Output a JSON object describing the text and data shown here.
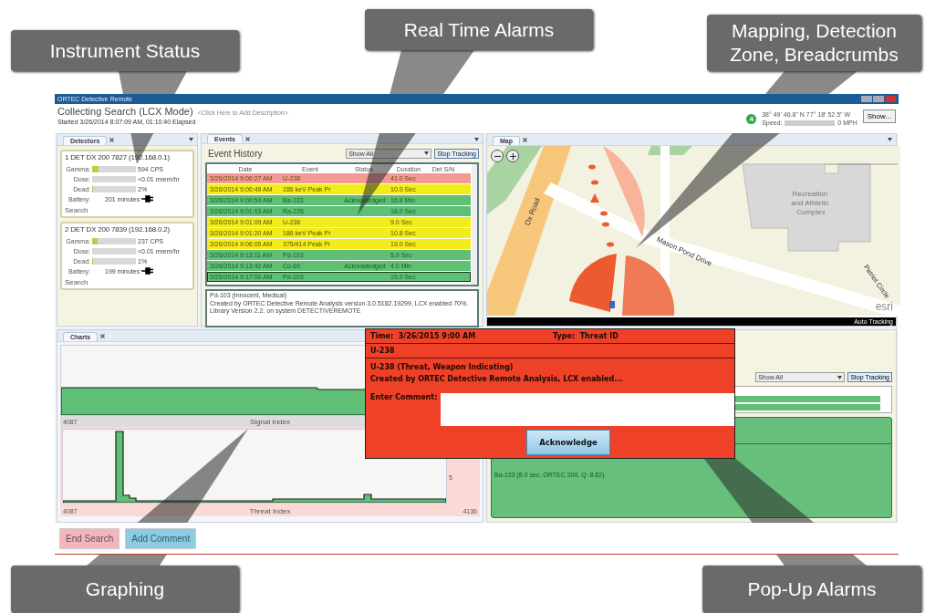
{
  "callouts": [
    {
      "label": "Instrument Status"
    },
    {
      "label": "Real Time Alarms"
    },
    {
      "label": "Mapping, Detection Zone, Breadcrumbs"
    },
    {
      "label": "Graphing"
    },
    {
      "label": "Pop-Up Alarms"
    }
  ],
  "window": {
    "title": "ORTEC Detective Remote",
    "search_title": "Collecting Search (LCX Mode)",
    "description_placeholder": "<Click Here to Add Description>",
    "started": "Started 3/26/2014 8:07:09 AM, 01:10:40 Elapsed",
    "gps_count": "4",
    "coordinates": "38° 49' 46.8\" N 77° 18' 52.5\" W",
    "speed_label": "Speed:",
    "speed": "0 MPH",
    "show_button": "Show..."
  },
  "detectors": {
    "tab": "Detectors",
    "items": [
      {
        "name": "1 DET DX 200 7827 (192.168.0.1)",
        "meters": [
          {
            "label": "Gamma:",
            "level": 0.15,
            "reading": "594 CPS"
          },
          {
            "label": "Dose:",
            "level": 0,
            "reading": "<0.01 mrem/hr"
          },
          {
            "label": "Dead:",
            "level": 0.02,
            "reading": "2%"
          }
        ],
        "battery_label": "Battery:",
        "battery": "201 minutes",
        "action": "Search"
      },
      {
        "name": "2 DET DX 200 7839 (192.168.0.2)",
        "meters": [
          {
            "label": "Gamma:",
            "level": 0.12,
            "reading": "237 CPS"
          },
          {
            "label": "Dose:",
            "level": 0,
            "reading": "<0.01 mrem/hr"
          },
          {
            "label": "Dead:",
            "level": 0.01,
            "reading": "1%"
          }
        ],
        "battery_label": "Battery:",
        "battery": "199 minutes",
        "action": "Search"
      }
    ]
  },
  "events": {
    "tab": "Events",
    "heading": "Event History",
    "filter": "Show All",
    "stop_button": "Stop Tracking",
    "columns": [
      "Date",
      "Event",
      "Status",
      "Duration",
      "Det S/N"
    ],
    "rows": [
      {
        "date": "3/26/2014 9:00:27 AM",
        "event": "U-238",
        "duration": "41.0 Sec",
        "color": "#f49a96",
        "selected": false
      },
      {
        "date": "3/26/2014 9:00:49 AM",
        "event": "186 keV Peak Pr",
        "duration": "10.0 Sec",
        "color": "#f2ec1a",
        "selected": false
      },
      {
        "date": "3/26/2014 9:00:54 AM",
        "event": "Ba-133",
        "status": "Acknowledged",
        "duration": "16.8 Min",
        "color": "#5fbf75",
        "selected": false
      },
      {
        "date": "3/26/2014 9:01:03 AM",
        "event": "Ra-226",
        "duration": "18.0 Sec",
        "color": "#5fbf75",
        "selected": false
      },
      {
        "date": "3/26/2014 9:01:09 AM",
        "event": "U-238",
        "duration": "9.0 Sec",
        "color": "#f2ec1a",
        "selected": false
      },
      {
        "date": "3/26/2014 9:01:20 AM",
        "event": "186 keV Peak Pr",
        "duration": "10.8 Sec",
        "color": "#f2ec1a",
        "selected": false
      },
      {
        "date": "3/26/2014 9:06:05 AM",
        "event": "375/414 Peak Pr",
        "duration": "19.0 Sec",
        "color": "#f2ec1a",
        "selected": false
      },
      {
        "date": "3/26/2014 9:13:11 AM",
        "event": "Pd-103",
        "duration": "5.9 Sec",
        "color": "#5fbf75",
        "selected": false
      },
      {
        "date": "3/26/2014 9:13:42 AM",
        "event": "Co-60",
        "status": "Acknowledged",
        "duration": "4.0 Min",
        "color": "#5fbf75",
        "selected": false
      },
      {
        "date": "3/26/2014 9:17:00 AM",
        "event": "Pd-103",
        "duration": "15.0 Sec",
        "color": "#5fbf75",
        "selected": true
      }
    ],
    "detail_title": "Pd-103 (Innocent, Medical)",
    "detail_text": "Created by ORTEC Detective Remote Analysis version 3.0.5182.19299. LCX enabled 70%. Library Version 2.2. on system DETECTIVEREMOTE"
  },
  "map": {
    "tab": "Map",
    "labels": [
      "Ox Road",
      "Mason Pond Drive",
      "Recreation and Athletic Complex",
      "Patriot Circle"
    ],
    "attribution": "esri",
    "status": "Auto Tracking"
  },
  "charts": {
    "tab": "Charts",
    "signal_label": "Signal Index",
    "signal_start": "4087",
    "threat_label": "Threat Index",
    "threat_start": "4087",
    "threat_end": "4136",
    "threat_tick": "5"
  },
  "events_lower": {
    "filter": "Show All",
    "stop_button": "Stop Tracking",
    "detail_text": "Ba-133 (8.0 sec, ORTEC 200, Q: 8.62)"
  },
  "buttons": [
    {
      "label": "End Search",
      "kind": "danger"
    },
    {
      "label": "Add Comment",
      "kind": "info"
    }
  ],
  "popup": {
    "time_label": "Time:",
    "time": "3/26/2015 9:00 AM",
    "type_label": "Type:",
    "type": "Threat ID",
    "nuclide": "U-238",
    "description": "U-238 (Threat, Weapon Indicating)",
    "created": "Created by ORTEC Detective Remote Analysis, LCX  enabled...",
    "comment_label": "Enter Comment:",
    "button": "Acknowledge"
  }
}
